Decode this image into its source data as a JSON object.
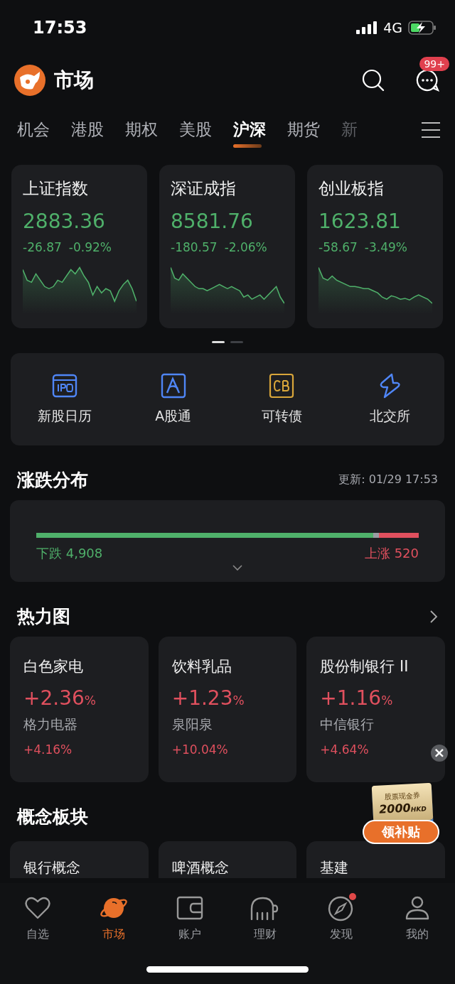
{
  "status_bar": {
    "time": "17:53",
    "network": "4G"
  },
  "header": {
    "title": "市场",
    "message_badge": "99+"
  },
  "tabs": [
    {
      "label": "机会",
      "selected": false,
      "clipped": false
    },
    {
      "label": "港股",
      "selected": false,
      "clipped": false
    },
    {
      "label": "期权",
      "selected": false,
      "clipped": false
    },
    {
      "label": "美股",
      "selected": false,
      "clipped": false
    },
    {
      "label": "沪深",
      "selected": true,
      "clipped": false
    },
    {
      "label": "期货",
      "selected": false,
      "clipped": false
    },
    {
      "label": "新",
      "selected": false,
      "clipped": true
    }
  ],
  "indices": [
    {
      "name": "上证指数",
      "price": "2883.36",
      "change": "-26.87",
      "percent": "-0.92%"
    },
    {
      "name": "深证成指",
      "price": "8581.76",
      "change": "-180.57",
      "percent": "-2.06%"
    },
    {
      "name": "创业板指",
      "price": "1623.81",
      "change": "-58.67",
      "percent": "-3.49%"
    }
  ],
  "pager": [
    {
      "selected": true
    },
    {
      "selected": false
    }
  ],
  "shortcuts": [
    {
      "label": "新股日历",
      "kind": "ipo"
    },
    {
      "label": "A股通",
      "kind": "a"
    },
    {
      "label": "可转债",
      "kind": "cb"
    },
    {
      "label": "北交所",
      "kind": "bolt"
    }
  ],
  "distribution": {
    "title": "涨跌分布",
    "updated": "更新: 01/29 17:53",
    "level": 0.895,
    "fall_label": "下跌",
    "fall_count": "4,908",
    "rise_label": "上涨",
    "rise_count": "520"
  },
  "heatmap": {
    "title": "热力图",
    "cards": [
      {
        "sector": "白色家电",
        "change": "+2.36",
        "unit": "%",
        "stock": "格力电器",
        "stock_change": "+4.16%"
      },
      {
        "sector": "饮料乳品",
        "change": "+1.23",
        "unit": "%",
        "stock": "泉阳泉",
        "stock_change": "+10.04%"
      },
      {
        "sector": "股份制银行 II",
        "change": "+1.16",
        "unit": "%",
        "stock": "中信银行",
        "stock_change": "+4.64%"
      }
    ]
  },
  "concepts": {
    "title": "概念板块",
    "cards": [
      "银行概念",
      "啤酒概念",
      "基建"
    ]
  },
  "promo": {
    "close": "×",
    "ticket_title": "股票现金券",
    "amount": "2000",
    "currency": "HKD",
    "button": "领补贴"
  },
  "nav": [
    {
      "label": "自选",
      "kind": "heart",
      "selected": false,
      "dot": false
    },
    {
      "label": "市场",
      "kind": "planet",
      "selected": true,
      "dot": false
    },
    {
      "label": "账户",
      "kind": "wallet",
      "selected": false,
      "dot": false
    },
    {
      "label": "理财",
      "kind": "elephant",
      "selected": false,
      "dot": false
    },
    {
      "label": "发现",
      "kind": "compass",
      "selected": false,
      "dot": true
    },
    {
      "label": "我的",
      "kind": "person",
      "selected": false,
      "dot": false
    }
  ]
}
